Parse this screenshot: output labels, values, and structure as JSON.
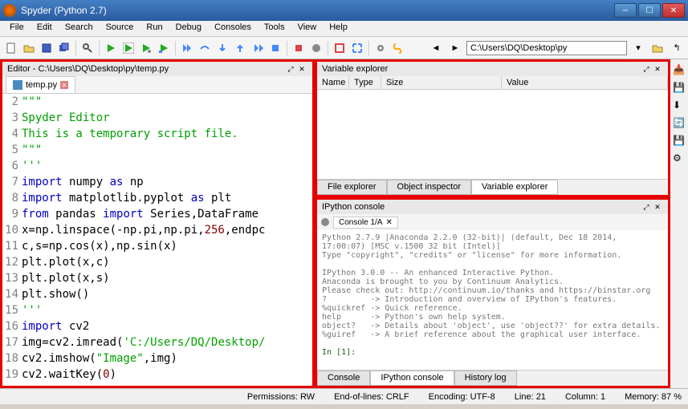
{
  "title": "Spyder (Python 2.7)",
  "menu": [
    "File",
    "Edit",
    "Search",
    "Source",
    "Run",
    "Debug",
    "Consoles",
    "Tools",
    "View",
    "Help"
  ],
  "path": "C:\\Users\\DQ\\Desktop\\py",
  "editor": {
    "pane_title": "Editor - C:\\Users\\DQ\\Desktop\\py\\temp.py",
    "tab": "temp.py",
    "lines": [
      {
        "n": 2,
        "html": "<span class='c-str'>\"\"\"</span>"
      },
      {
        "n": 3,
        "html": "<span class='c-str'>Spyder Editor</span>"
      },
      {
        "n": 4,
        "html": "<span class='c-str'>This is a temporary script file.</span>"
      },
      {
        "n": 5,
        "html": "<span class='c-str'>\"\"\"</span>"
      },
      {
        "n": 6,
        "html": "<span class='c-str'>'''</span>"
      },
      {
        "n": 7,
        "html": "<span class='c-kw'>import</span> numpy <span class='c-kw'>as</span> np"
      },
      {
        "n": 8,
        "html": "<span class='c-kw'>import</span> matplotlib.pyplot <span class='c-kw'>as</span> plt"
      },
      {
        "n": 9,
        "html": "<span class='c-kw'>from</span> pandas <span class='c-kw'>import</span> Series,DataFrame"
      },
      {
        "n": 10,
        "html": "x=np.linspace(-np.pi,np.pi,<span class='c-num'>256</span>,endpc"
      },
      {
        "n": 11,
        "html": "c,s=np.cos(x),np.sin(x)"
      },
      {
        "n": 12,
        "html": "plt.plot(x,c)"
      },
      {
        "n": 13,
        "html": "plt.plot(x,s)"
      },
      {
        "n": 14,
        "html": "plt.show()"
      },
      {
        "n": 15,
        "html": "<span class='c-str'>'''</span>"
      },
      {
        "n": 16,
        "html": "<span class='c-kw'>import</span> cv2"
      },
      {
        "n": 17,
        "html": "img=cv2.imread(<span class='c-str'>'C:/Users/DQ/Desktop/</span>"
      },
      {
        "n": 18,
        "html": "cv2.imshow(<span class='c-str'>\"Image\"</span>,img)"
      },
      {
        "n": 19,
        "html": "cv2.waitKey(<span class='c-num'>0</span>)"
      }
    ]
  },
  "varex": {
    "title": "Variable explorer",
    "cols": {
      "name": "Name",
      "type": "Type",
      "size": "Size",
      "value": "Value"
    },
    "tabs": [
      "File explorer",
      "Object inspector",
      "Variable explorer"
    ]
  },
  "ipy": {
    "title": "IPython console",
    "tab": "Console 1/A",
    "text": "Python 2.7.9 |Anaconda 2.2.0 (32-bit)| (default, Dec 18 2014, 17:00:07) [MSC v.1500 32 bit (Intel)]\nType \"copyright\", \"credits\" or \"license\" for more information.\n\nIPython 3.0.0 -- An enhanced Interactive Python.\nAnaconda is brought to you by Continuum Analytics.\nPlease check out: http://continuum.io/thanks and https://binstar.org\n?         -> Introduction and overview of IPython's features.\n%quickref -> Quick reference.\nhelp      -> Python's own help system.\nobject?   -> Details about 'object', use 'object??' for extra details.\n%guiref   -> A brief reference about the graphical user interface.",
    "prompt": "In [1]:",
    "tabs": [
      "Console",
      "IPython console",
      "History log"
    ]
  },
  "status": {
    "perm": "Permissions: RW",
    "eol": "End-of-lines: CRLF",
    "enc": "Encoding: UTF-8",
    "line": "Line: 21",
    "col": "Column: 1",
    "mem": "Memory: 87 %"
  }
}
